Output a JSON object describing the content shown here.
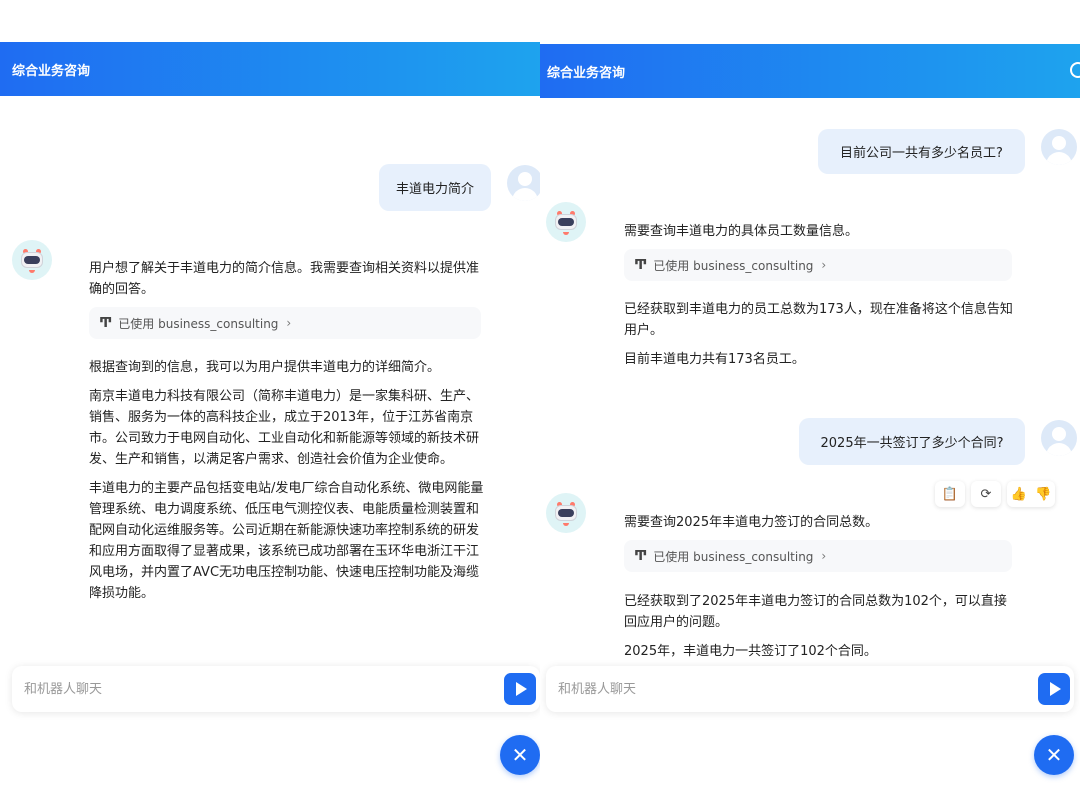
{
  "left": {
    "header_title": "综合业务咨询",
    "user_message": "丰道电力简介",
    "bot_thought": "用户想了解关于丰道电力的简介信息。我需要查询相关资料以提供准确的回答。",
    "tool_label": "已使用 business_consulting",
    "paragraphs": [
      "根据查询到的信息，我可以为用户提供丰道电力的详细简介。",
      "南京丰道电力科技有限公司（简称丰道电力）是一家集科研、生产、销售、服务为一体的高科技企业，成立于2013年，位于江苏省南京市。公司致力于电网自动化、工业自动化和新能源等领域的新技术研发、生产和销售，以满足客户需求、创造社会价值为企业使命。",
      "丰道电力的主要产品包括变电站/发电厂综合自动化系统、微电网能量管理系统、电力调度系统、低压电气测控仪表、电能质量检测装置和配网自动化运维服务等。公司近期在新能源快速功率控制系统的研发和应用方面取得了显著成果，该系统已成功部署在玉环华电浙江干江风电场，并内置了AVC无功电压控制功能、快速电压控制功能及海缆降损功能。"
    ],
    "input_placeholder": "和机器人聊天"
  },
  "right": {
    "header_title": "综合业务咨询",
    "q1": "目前公司一共有多少名员工?",
    "a1_thought": "需要查询丰道电力的具体员工数量信息。",
    "a1_tool": "已使用 business_consulting",
    "a1_result": "已经获取到丰道电力的员工总数为173人，现在准备将这个信息告知用户。",
    "a1_answer": "目前丰道电力共有173名员工。",
    "q2": "2025年一共签订了多少个合同?",
    "a2_thought": "需要查询2025年丰道电力签订的合同总数。",
    "a2_tool": "已使用 business_consulting",
    "a2_result": "已经获取到了2025年丰道电力签订的合同总数为102个，可以直接回应用户的问题。",
    "a2_answer": "2025年，丰道电力一共签订了102个合同。",
    "input_placeholder": "和机器人聊天"
  },
  "icons": {
    "tool": "Ͳ",
    "chevron": "›",
    "copy": "📋",
    "regenerate": "⟳",
    "thumbs_up": "👍",
    "thumbs_down": "👎",
    "close": "✕"
  },
  "colors": {
    "header_start": "#1f6cf2",
    "header_end": "#1ea3ee",
    "accent": "#1f6cf2",
    "user_bubble": "#e7f0fc"
  }
}
